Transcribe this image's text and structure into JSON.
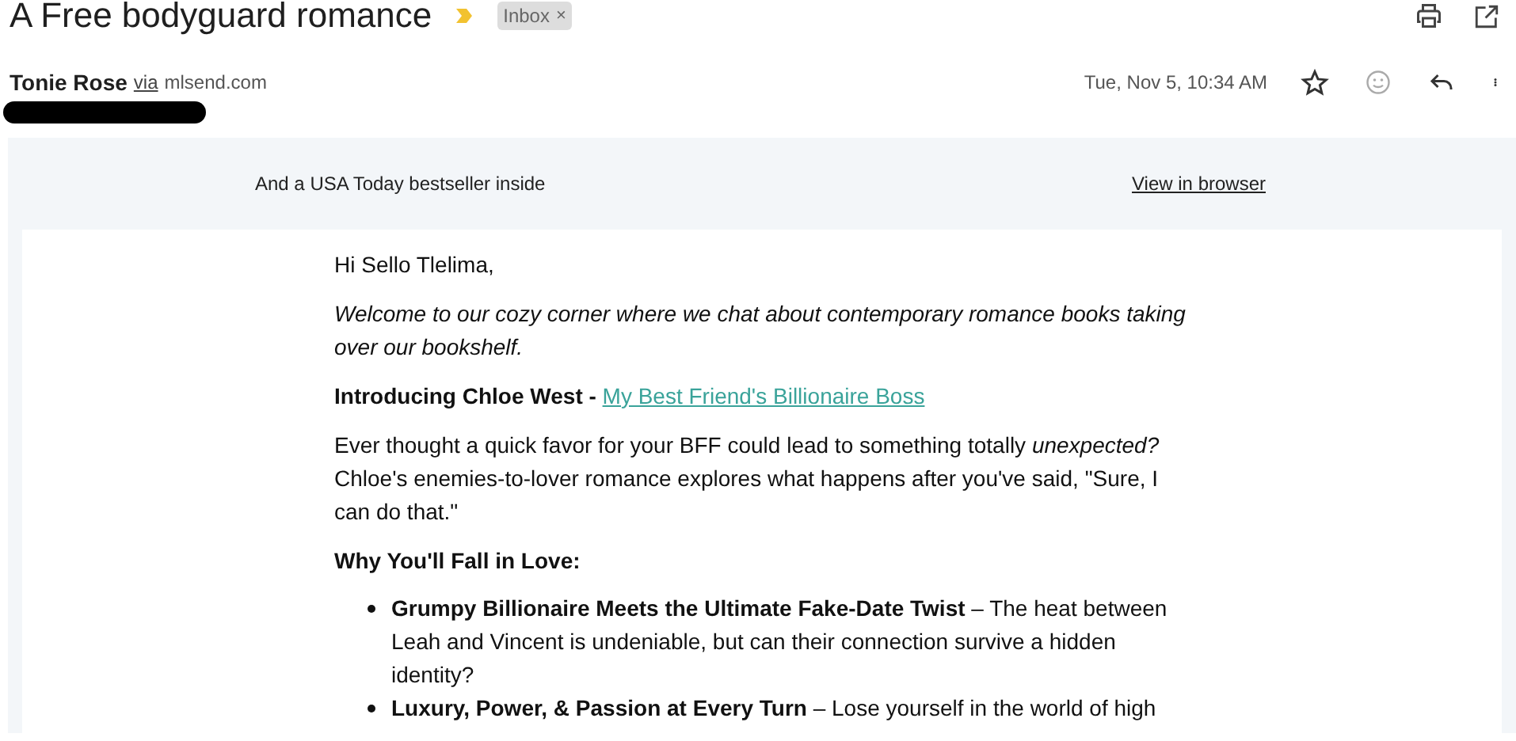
{
  "subject": "A Free bodyguard romance",
  "important": true,
  "labels": [
    {
      "text": "Inbox",
      "remove": "×"
    }
  ],
  "sender": {
    "name": "Tonie Rose",
    "via": "via",
    "domain": "mlsend.com",
    "redacted": true,
    "date": "Tue, Nov 5, 10:34 AM",
    "starred": false
  },
  "preheader": {
    "text": "And a USA Today bestseller inside",
    "link": "View in browser"
  },
  "body": [
    {
      "kind": "para",
      "text": "Hi Sello Tlelima,"
    },
    {
      "kind": "italic",
      "text": "Welcome to our cozy corner where we chat about contemporary romance books taking over our bookshelf."
    },
    {
      "kind": "intro",
      "text": "Introducing Chloe West - ",
      "link": "My Best Friend's Billionaire Boss"
    },
    {
      "kind": "rich",
      "text": "Ever thought a quick favor for your BFF could lead to something totally *unexpected?* Chloe's enemies-to-lover romance explores what happens after you've said, \"Sure, I can do that.\""
    },
    {
      "kind": "heading",
      "text": "Why You'll Fall in Love:"
    },
    {
      "kind": "list",
      "items": [
        {
          "title": "Grumpy Billionaire Meets the Ultimate Fake-Date Twist",
          "text": " – The heat between Leah and Vincent is undeniable, but can their connection survive a hidden identity?"
        },
        {
          "title": "Luxury, Power, & Passion at Every Turn",
          "text": " – Lose yourself in the world of high"
        }
      ]
    }
  ]
}
